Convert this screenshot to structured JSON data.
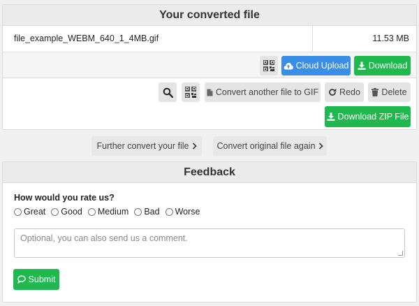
{
  "converted": {
    "title": "Your converted file",
    "file_name": "file_example_WEBM_640_1_4MB.gif",
    "file_size": "11.53 MB",
    "cloud_upload_label": "Cloud Upload",
    "download_label": "Download",
    "convert_another_label": "Convert another file to GIF",
    "redo_label": "Redo",
    "delete_label": "Delete",
    "download_zip_label": "Download ZIP File"
  },
  "further": {
    "further_convert_label": "Further convert your file",
    "convert_original_label": "Convert original file again"
  },
  "feedback": {
    "title": "Feedback",
    "question": "How would you rate us?",
    "options": [
      "Great",
      "Good",
      "Medium",
      "Bad",
      "Worse"
    ],
    "comment_placeholder": "Optional, you can also send us a comment.",
    "submit_label": "Submit"
  },
  "colors": {
    "blue": "#3b8ee8",
    "green": "#1fb94f"
  }
}
